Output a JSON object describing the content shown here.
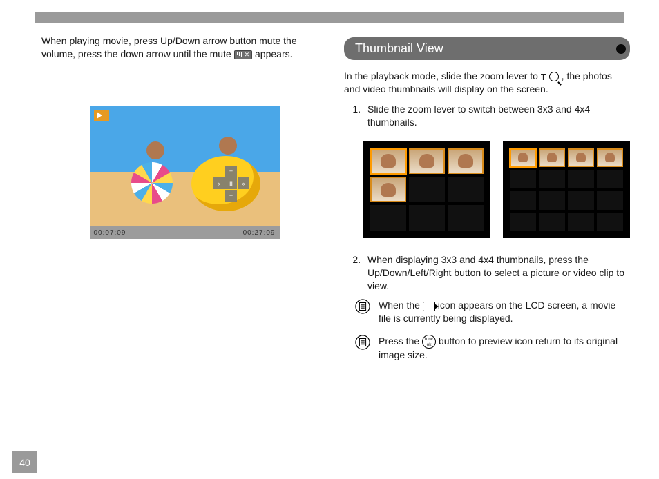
{
  "page_number": "40",
  "left": {
    "paragraph_before_icon": "When playing movie, press Up/Down arrow button mute the volume, press the down arrow until the mute ",
    "paragraph_after_icon": " appears.",
    "time_elapsed": "00:07:09",
    "time_total": "00:27:09",
    "ctrl": {
      "up": "+",
      "left": "«",
      "center": "II",
      "right": "»",
      "down": "−"
    }
  },
  "right": {
    "header": "Thumbnail View",
    "intro_before": "In the playback mode, slide the zoom lever to ",
    "intro_zoom_label": "T",
    "intro_after": " , the photos and video thumbnails will display on the screen.",
    "step1": "Slide the zoom lever to switch between 3x3 and 4x4 thumbnails.",
    "step2": "When displaying 3x3 and 4x4 thumbnails, press the Up/Down/Left/Right button to select a picture or video clip to view.",
    "note1_before": "When the ",
    "note1_after": " icon appears on the LCD screen, a movie file is currently being displayed.",
    "note2_before": "Press the ",
    "note2_func": "func\nok",
    "note2_after": " button to preview icon return to its original image size."
  }
}
